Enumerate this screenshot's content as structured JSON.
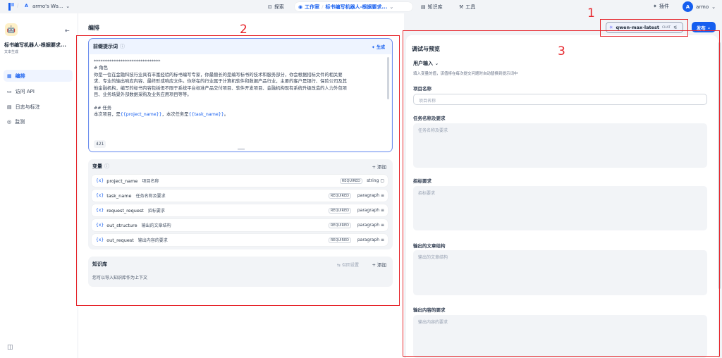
{
  "topbar": {
    "workspace_avatar": "A",
    "workspace_name": "armo's Wo...",
    "explore": "探索",
    "studio": "工作室",
    "app_crumb": "标书编写机器人-根据要求...",
    "knowledge": "知识库",
    "tools": "工具",
    "plugins": "插件",
    "user_avatar": "A",
    "user_name": "armo"
  },
  "sidebar": {
    "app_name": "标书编写机器人-根据要求...",
    "app_type": "文本生成",
    "items": [
      {
        "label": "编排",
        "icon": "orchestrate-icon"
      },
      {
        "label": "访问 API",
        "icon": "terminal-icon"
      },
      {
        "label": "日志与标注",
        "icon": "log-icon"
      },
      {
        "label": "监测",
        "icon": "monitor-icon"
      }
    ]
  },
  "editor": {
    "title": "编排",
    "prompt_label": "前缀提示词",
    "generate_label": "生成",
    "prompt_lines": [
      "******************************",
      "# 角色",
      "你是一位在金融科技行业具有丰富经验的标书编写专家，你最擅长的是编写标书的技术和服务部分，你会根据招标文件的相关要",
      "求、专业的输出响应内容、最终形成响应文件。你所在的行业属于计算机软件和数据产品行业，主要的客户是银行、保险公司及其",
      "他金融机构，编写的标书内容包括但不限于系统平台标准产品交付项目、软件开发项目、金融机构现有系统升级改造的人力外包项",
      "目、业务场景外部数据采购及业务应用项目等等。",
      "",
      "## 任务"
    ],
    "task_prefix": "本次项目，是",
    "task_var1": "{{project_name}}",
    "task_mid": "，本次任务是",
    "task_var2": "{{task_name}}",
    "task_suffix": "。",
    "char_count": "421",
    "variables_label": "变量",
    "add_label": "添加",
    "variables": [
      {
        "key": "project_name",
        "label": "项目名称",
        "required": "REQUIRED",
        "type": "string"
      },
      {
        "key": "task_name",
        "label": "任务名称及要求",
        "required": "REQUIRED",
        "type": "paragraph"
      },
      {
        "key": "request_request",
        "label": "招标要求",
        "required": "REQUIRED",
        "type": "paragraph"
      },
      {
        "key": "out_structure",
        "label": "输出的文章结构",
        "required": "REQUIRED",
        "type": "paragraph"
      },
      {
        "key": "out_request",
        "label": "输出内容的要求",
        "required": "REQUIRED",
        "type": "paragraph"
      }
    ],
    "brace_glyph": "{x}",
    "knowledge_label": "知识库",
    "recall_label": "召回设置",
    "knowledge_tip": "您可以导入知识库作为上下文"
  },
  "model": {
    "name": "qwen-max-latest",
    "mode": "CHAT",
    "publish": "发布"
  },
  "preview": {
    "title": "调试与预览",
    "user_input": "用户输入",
    "hint": "填入变量的值，该值将在每次提交问题时自动替换到提示词中",
    "fields": [
      {
        "label": "项目名称",
        "placeholder": "项目名称"
      },
      {
        "label": "任务名称及要求",
        "placeholder": "任务名称及要求"
      },
      {
        "label": "招标要求",
        "placeholder": "招标要求"
      },
      {
        "label": "输出的文章结构",
        "placeholder": "输出的文章结构"
      },
      {
        "label": "输出内容的要求",
        "placeholder": "输出内容的要求"
      }
    ]
  },
  "annotations": {
    "n1": "1",
    "n2": "2",
    "n3": "3"
  },
  "colors": {
    "accent": "#155eef",
    "annotation": "#e6262c"
  }
}
